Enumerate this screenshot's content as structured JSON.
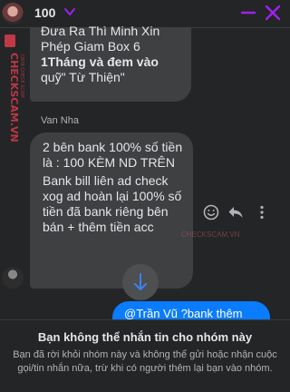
{
  "header": {
    "name": "100",
    "colors": {
      "accent": "#a020f0"
    }
  },
  "messages": {
    "first_bubble_lines": [
      "Đưa Ra Thì Minh Xin",
      "Phép Giam Box 6",
      "1Tháng và đem vào",
      "quỹ\" Từ Thiện\""
    ],
    "sender": "Van Nha",
    "second_bubble_paragraphs": [
      "2 bên bank 100% số tiền là : 100 KÈM ND TRÊN",
      "Bank bill liên ad check xog ad hoàn lại 100% số tiền đã bank riêng bên bán + thêm tiền acc"
    ],
    "outgoing_preview": "@Trần Vũ ?bank thêm"
  },
  "watermark": {
    "side_text": "CHECKSCAM.VN",
    "side_small": "DATA CHECK SCAM",
    "inline_text": "CHECKSCAM.VN"
  },
  "footer": {
    "title": "Bạn không thể nhắn tin cho nhóm này",
    "description": "Bạn đã rời khỏi nhóm này và không thể gửi hoặc nhận cuộc gọi/tin nhắn nữa, trừ khi có người thêm lại bạn vào nhóm."
  },
  "icons": {
    "minimize": "minimize-icon",
    "close": "close-icon",
    "chevron": "chevron-down-icon",
    "react": "smile-icon",
    "reply": "reply-icon",
    "more": "more-vertical-icon",
    "scroll": "arrow-down-icon"
  }
}
